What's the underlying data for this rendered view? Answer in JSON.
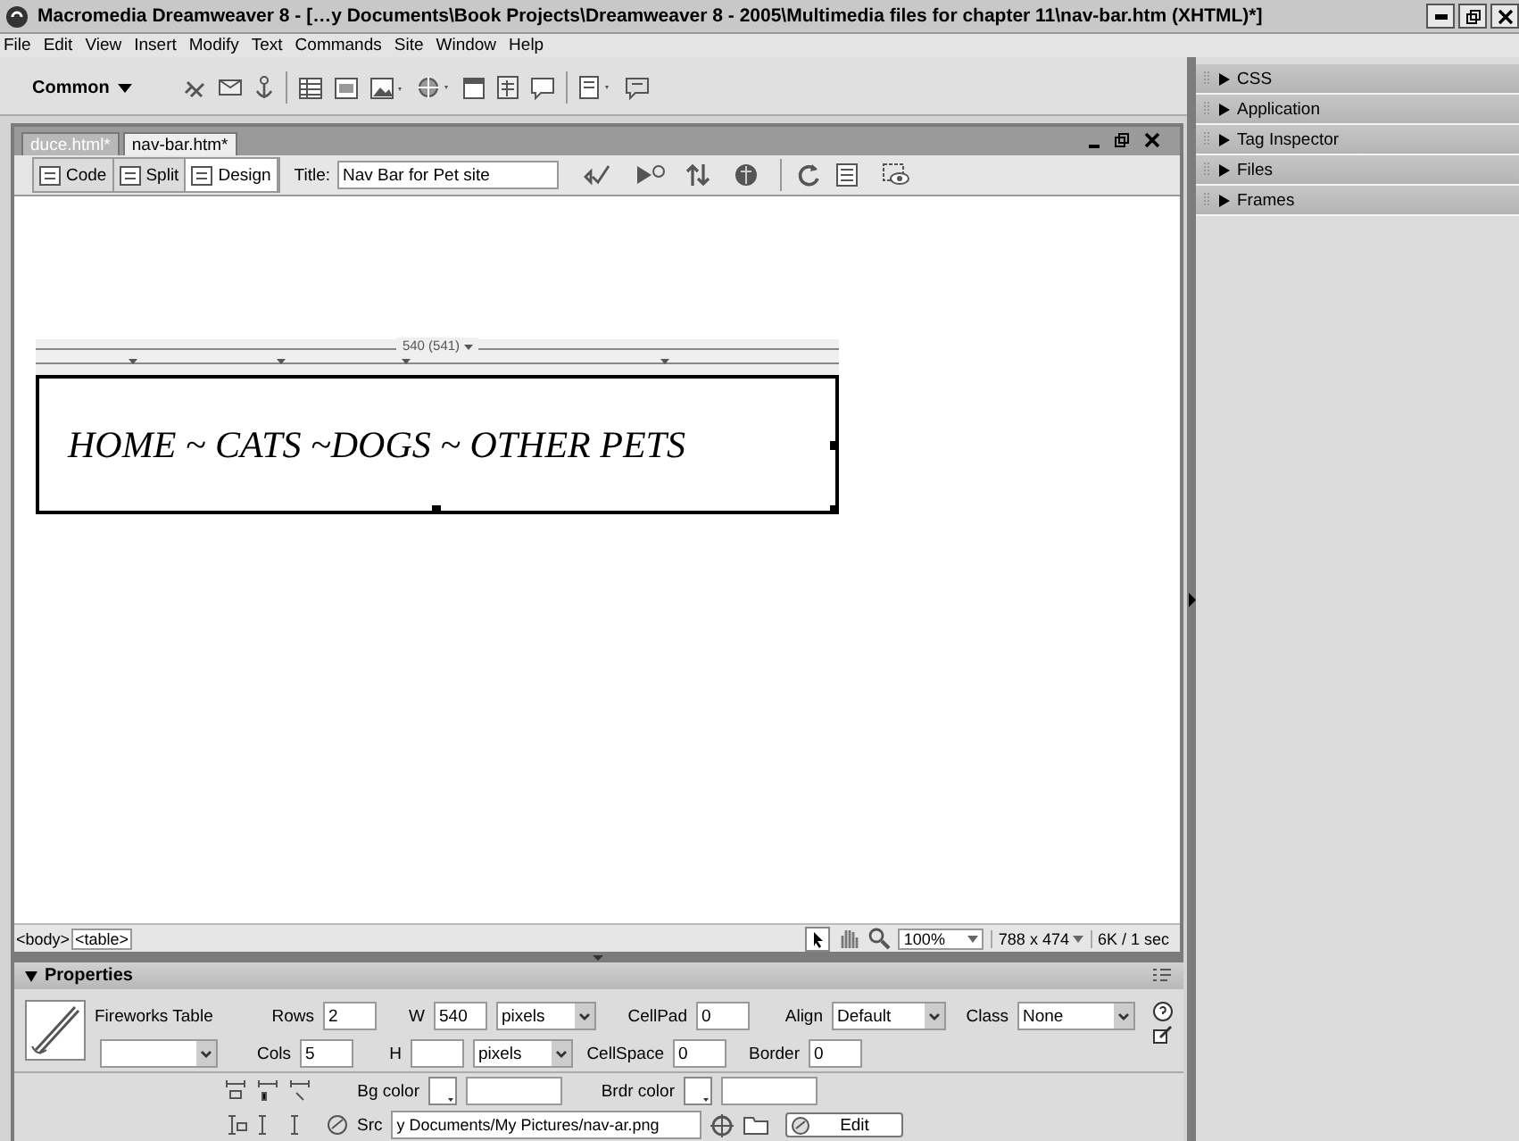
{
  "window": {
    "title": "Macromedia Dreamweaver 8 - […y Documents\\Book Projects\\Dreamweaver 8 - 2005\\Multimedia files for chapter 11\\nav-bar.htm (XHTML)*]"
  },
  "menu": [
    "File",
    "Edit",
    "View",
    "Insert",
    "Modify",
    "Text",
    "Commands",
    "Site",
    "Window",
    "Help"
  ],
  "insert_bar": {
    "category": "Common"
  },
  "doc_tabs": [
    {
      "label": "duce.html*",
      "selected": false
    },
    {
      "label": "nav-bar.htm*",
      "selected": true
    }
  ],
  "view_buttons": [
    {
      "label": "Code",
      "selected": false
    },
    {
      "label": "Split",
      "selected": false
    },
    {
      "label": "Design",
      "selected": true
    }
  ],
  "doc_title": {
    "label": "Title:",
    "value": "Nav Bar for Pet site"
  },
  "canvas": {
    "width_label": "540 (541)",
    "nav_text": "HOME ~ CATS ~DOGS ~ OTHER PETS"
  },
  "status_bar": {
    "tags": [
      {
        "label": "<body>",
        "selected": false
      },
      {
        "label": "<table>",
        "selected": true
      }
    ],
    "zoom": "100%",
    "size": "788 x 474",
    "download": "6K / 1 sec"
  },
  "properties": {
    "heading": "Properties",
    "expanded": true,
    "name_label": "Fireworks Table",
    "rows_label": "Rows",
    "rows": "2",
    "cols_label": "Cols",
    "cols": "5",
    "w_label": "W",
    "w": "540",
    "w_unit": "pixels",
    "h_label": "H",
    "h_unit": "pixels",
    "cellpad_label": "CellPad",
    "cellpad": "0",
    "cellspace_label": "CellSpace",
    "cellspace": "0",
    "align_label": "Align",
    "align": "Default",
    "border_label": "Border",
    "border": "0",
    "class_label": "Class",
    "class": "None",
    "bgcolor_label": "Bg color",
    "brdrcolor_label": "Brdr color",
    "src_label": "Src",
    "src": "y Documents/My Pictures/nav-ar.png",
    "edit_button": "Edit"
  },
  "panels": [
    {
      "label": "CSS",
      "expanded": false
    },
    {
      "label": "Application",
      "expanded": false
    },
    {
      "label": "Tag Inspector",
      "expanded": false
    },
    {
      "label": "Files",
      "expanded": false
    },
    {
      "label": "Frames",
      "expanded": false
    }
  ]
}
